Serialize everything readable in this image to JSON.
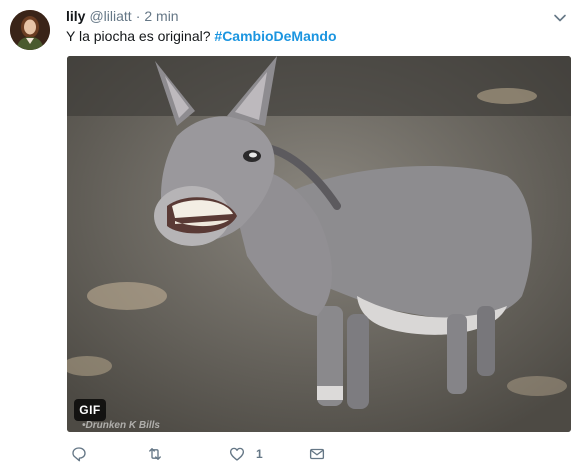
{
  "tweet": {
    "author_name": "lily",
    "author_handle": "@liliatt",
    "separator": "·",
    "time": "2 min",
    "text_plain": "Y la piocha es original? ",
    "hashtag": "#CambioDeMando",
    "media": {
      "badge": "GIF",
      "watermark": "•Drunken K Bills"
    },
    "actions": {
      "reply_count": "",
      "retweet_count": "",
      "like_count": "1",
      "dm_count": ""
    }
  },
  "icons": {
    "caret": "chevron-down-icon",
    "reply": "reply-icon",
    "retweet": "retweet-icon",
    "like": "heart-icon",
    "dm": "envelope-icon"
  },
  "colors": {
    "text": "#14171a",
    "secondary": "#657786",
    "link": "#1b95e0"
  }
}
